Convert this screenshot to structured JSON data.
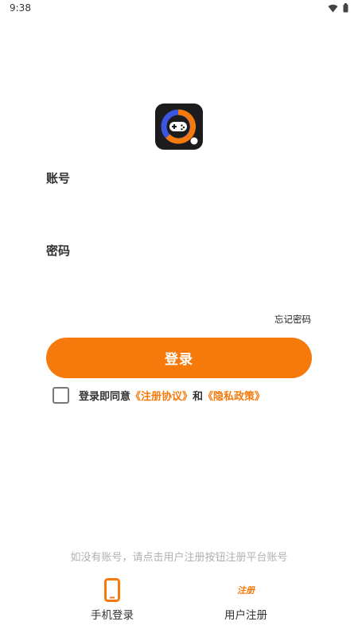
{
  "status_bar": {
    "time": "9:38",
    "icons": [
      "wifi-icon",
      "battery-icon"
    ]
  },
  "logo": {
    "icon": "gamepad-icon"
  },
  "account": {
    "label": "账号",
    "value": "",
    "placeholder": ""
  },
  "password": {
    "label": "密码",
    "value": "",
    "placeholder": ""
  },
  "forgot_password": "忘记密码",
  "login_button": "登录",
  "agreement": {
    "checked": false,
    "prefix": "登录即同意",
    "link1": "《注册协议》",
    "joiner": "和",
    "link2": "《隐私政策》"
  },
  "hint": "如没有账号，请点击用户注册按钮注册平台账号",
  "bottom_options": {
    "phone_login": {
      "icon": "phone-icon",
      "label": "手机登录"
    },
    "user_register": {
      "icon": "register-icon",
      "icon_text": "注册",
      "label": "用户注册"
    }
  },
  "colors": {
    "accent": "#f57a0b",
    "hint": "#b0b0b0",
    "logo_bg": "#1c1c1e",
    "logo_ring_blue": "#3b56e0"
  }
}
